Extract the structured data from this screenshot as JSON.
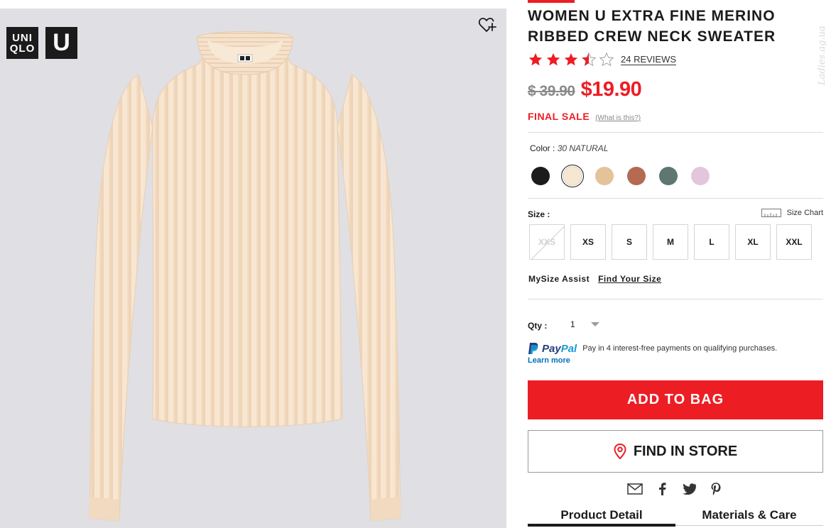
{
  "gallery": {
    "logo_uniqlo_line1": "UNI",
    "logo_uniqlo_line2": "QLO",
    "logo_u": "U",
    "wishlist_icon": "heart-plus-icon",
    "sweater_color": "#f7e4cf"
  },
  "watermark": "Ladies.ag.ua",
  "product": {
    "title": "WOMEN U EXTRA FINE MERINO RIBBED CREW NECK SWEATER",
    "rating": 3.5,
    "rating_max": 5,
    "reviews_label": "24 REVIEWS",
    "old_price": "$ 39.90",
    "new_price": "$19.90",
    "final_sale_label": "FINAL SALE",
    "final_sale_help": "(What is this?)"
  },
  "color": {
    "label": "Color :",
    "value": "30 NATURAL",
    "swatches": [
      {
        "name": "black",
        "hex": "#1c1c1c",
        "selected": false
      },
      {
        "name": "natural",
        "hex": "#f6e6d2",
        "selected": true
      },
      {
        "name": "beige",
        "hex": "#e4c29a",
        "selected": false
      },
      {
        "name": "brown",
        "hex": "#b56a52",
        "selected": false
      },
      {
        "name": "green",
        "hex": "#5f7671",
        "selected": false
      },
      {
        "name": "pink",
        "hex": "#e3c6dc",
        "selected": false
      }
    ]
  },
  "size": {
    "label": "Size :",
    "chart_label": "Size Chart",
    "options": [
      {
        "label": "XXS",
        "available": false
      },
      {
        "label": "XS",
        "available": true
      },
      {
        "label": "S",
        "available": true
      },
      {
        "label": "M",
        "available": true
      },
      {
        "label": "L",
        "available": true
      },
      {
        "label": "XL",
        "available": true
      },
      {
        "label": "XXL",
        "available": true
      }
    ],
    "assist_label": "MySize Assist",
    "assist_link": "Find Your Size"
  },
  "qty": {
    "label": "Qty :",
    "value": "1"
  },
  "paypal": {
    "brand_pay": "Pay",
    "brand_pal": "Pal",
    "text": "Pay in 4 interest-free payments on qualifying purchases.",
    "learn_more": "Learn more"
  },
  "actions": {
    "add_to_bag": "ADD TO BAG",
    "find_in_store": "FIND IN STORE"
  },
  "share_icons": [
    "email-icon",
    "facebook-icon",
    "twitter-icon",
    "pinterest-icon"
  ],
  "tabs": [
    {
      "label": "Product Detail",
      "active": true
    },
    {
      "label": "Materials & Care",
      "active": false
    }
  ],
  "colors": {
    "accent": "#ed1d24",
    "text": "#1b1b1b",
    "gallery_bg": "#e0dfe3"
  }
}
